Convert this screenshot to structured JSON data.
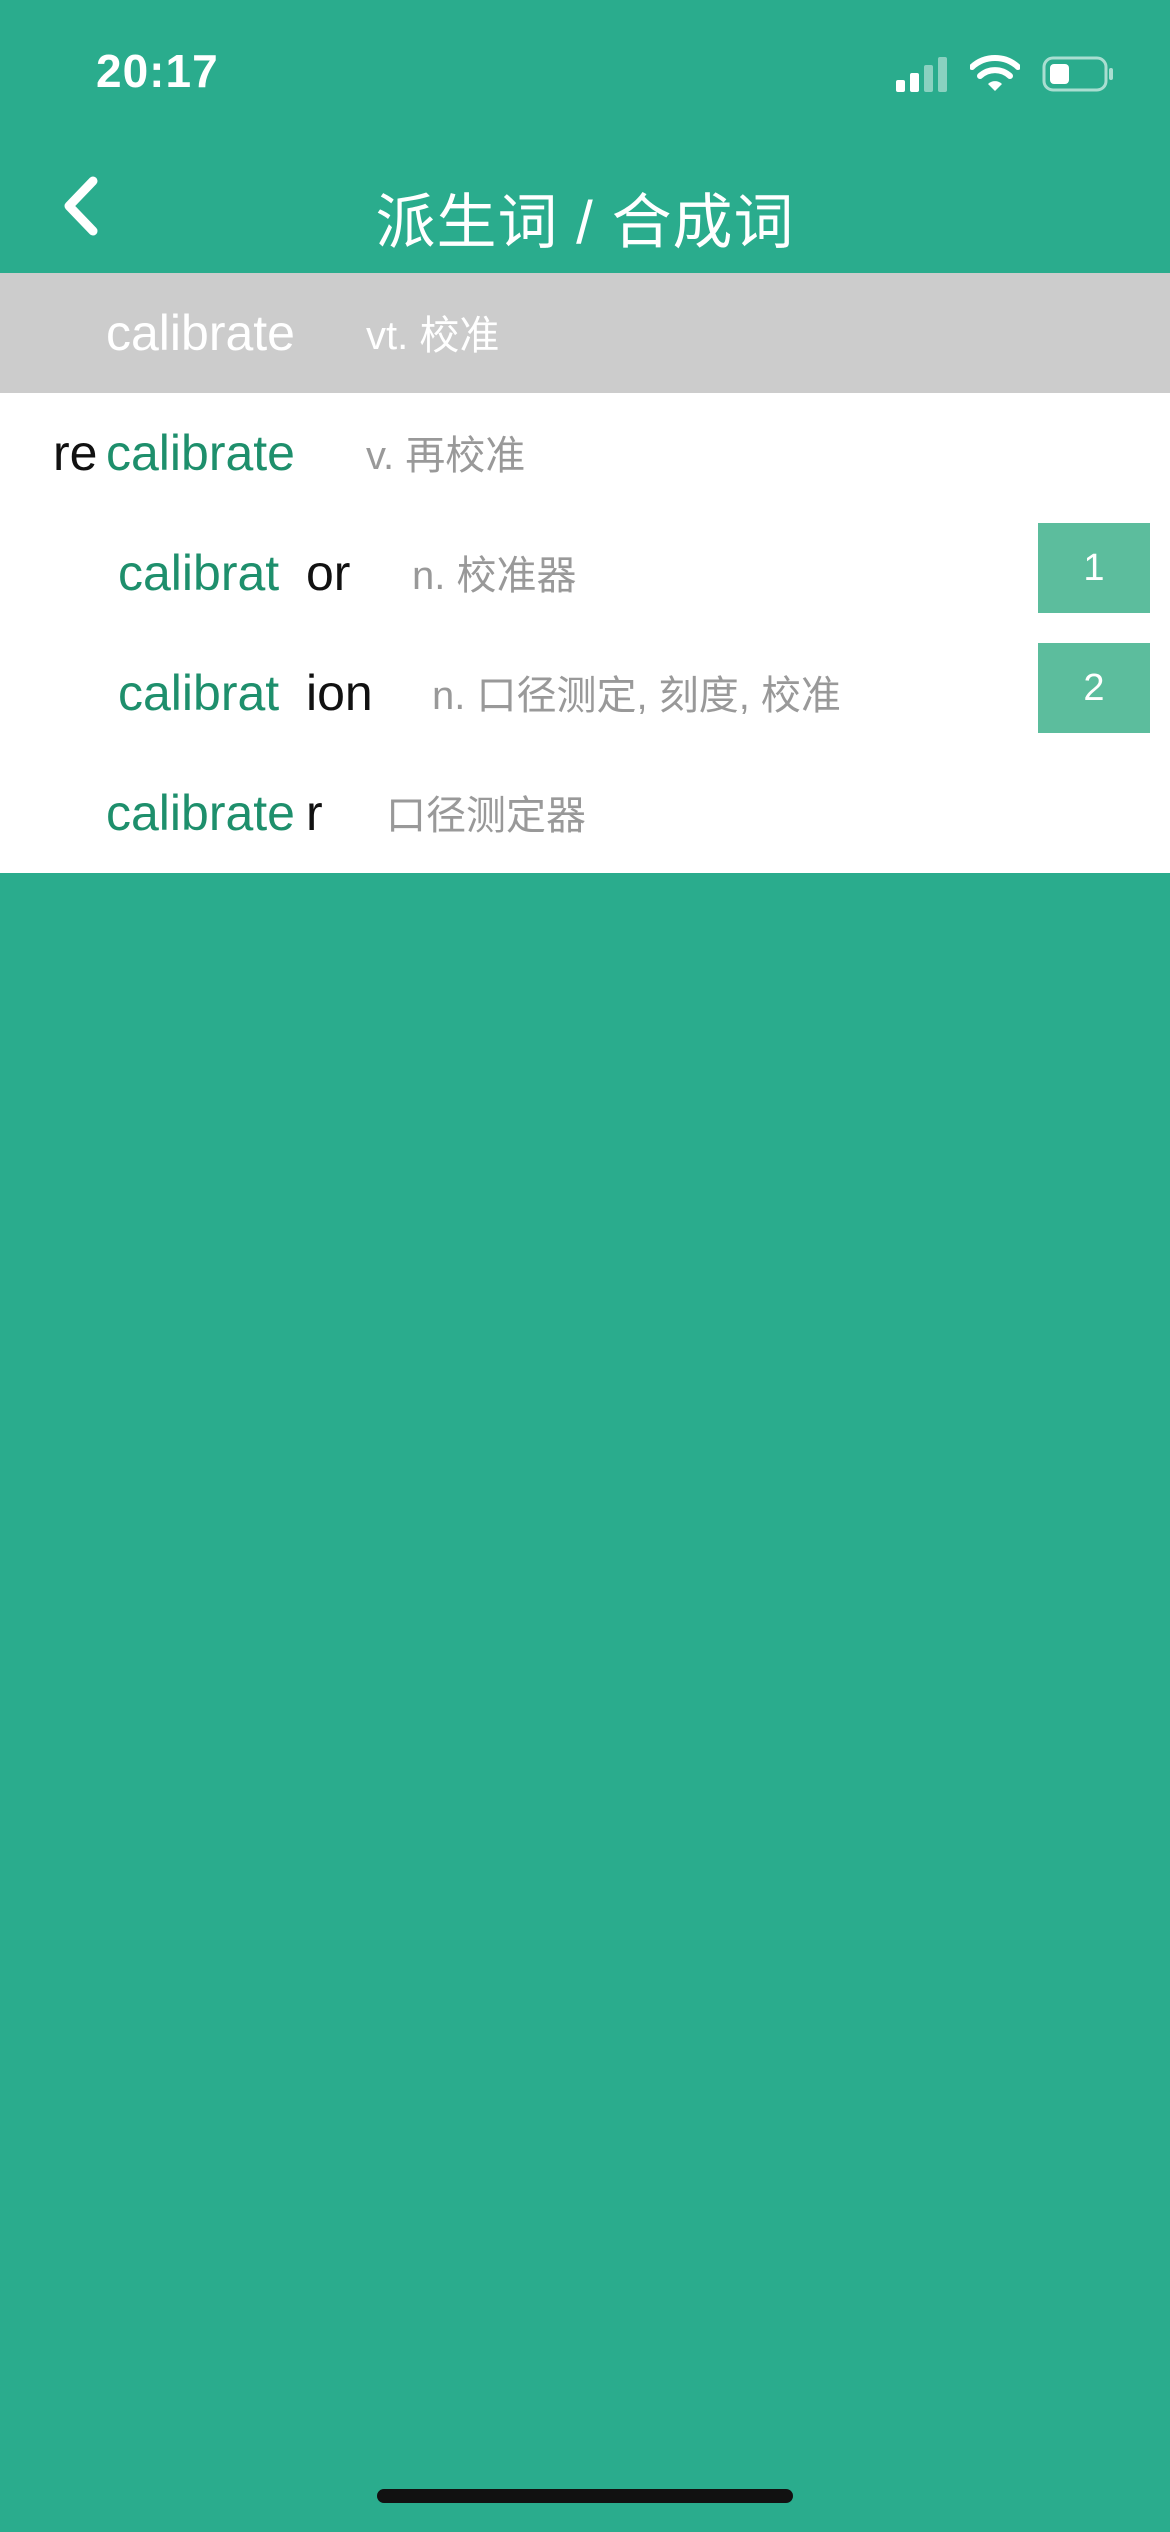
{
  "status_bar": {
    "time": "20:17",
    "icons": [
      "cellular-signal-icon",
      "wifi-icon",
      "battery-icon"
    ]
  },
  "nav": {
    "title": "派生词 / 合成词",
    "back_icon": "chevron-left-icon"
  },
  "colors": {
    "background": "#2aac8d",
    "root_text": "#1e8f6c",
    "badge": "#5cbd9d",
    "header_row": "#cccccc"
  },
  "entries": [
    {
      "root": "calibrate",
      "definition": "vt. 校准"
    },
    {
      "prefix": "re",
      "root": "calibrate",
      "definition": "v. 再校准"
    },
    {
      "root": "calibrat",
      "suffix": "or",
      "definition": "n. 校准器",
      "badge": "1"
    },
    {
      "root": "calibrat",
      "suffix": "ion",
      "definition": "n. 口径测定, 刻度, 校准",
      "badge": "2"
    },
    {
      "root": "calibrate",
      "suffix": "r",
      "definition": "口径测定器"
    }
  ]
}
